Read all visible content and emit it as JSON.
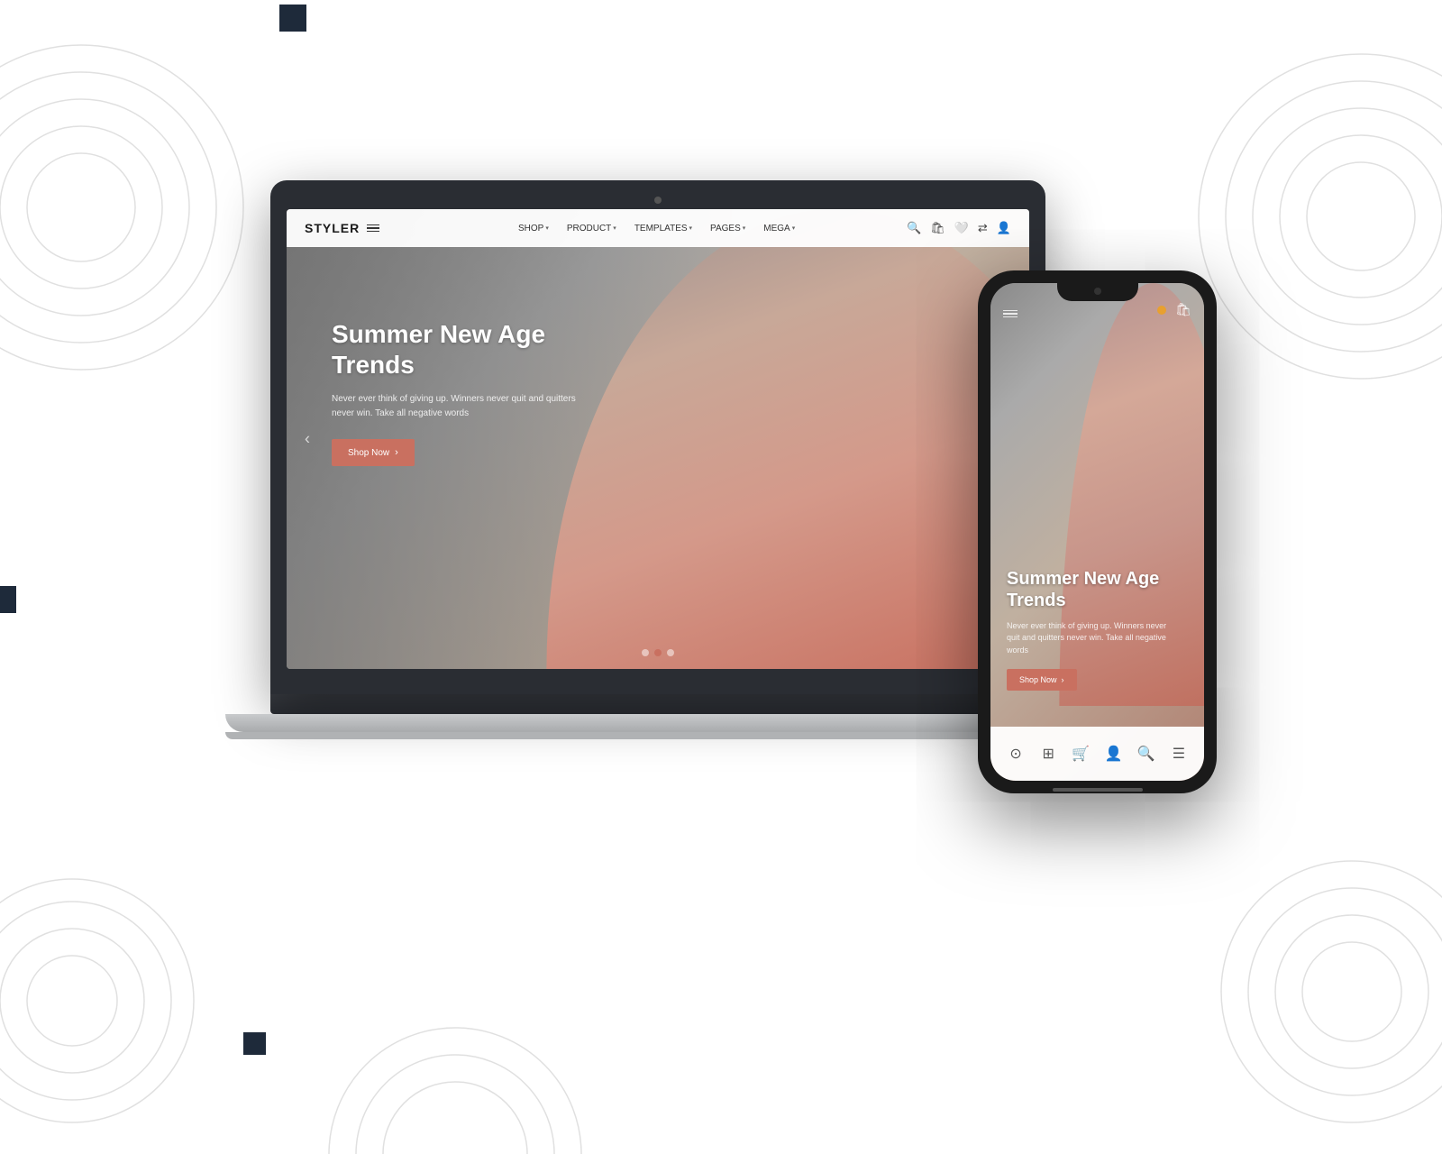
{
  "background": {
    "color": "#ffffff"
  },
  "laptop": {
    "nav": {
      "logo": "STYLER",
      "links": [
        {
          "label": "SHOP",
          "has_dropdown": true
        },
        {
          "label": "PRODUCT",
          "has_dropdown": true
        },
        {
          "label": "TEMPLATES",
          "has_dropdown": true
        },
        {
          "label": "PAGES",
          "has_dropdown": true
        },
        {
          "label": "MEGA",
          "has_dropdown": true
        }
      ]
    },
    "hero": {
      "title": "Summer New Age Trends",
      "subtitle": "Never ever think of giving up. Winners never quit and quitters never win. Take all negative words",
      "cta_label": "Shop Now"
    }
  },
  "phone": {
    "hero": {
      "title": "Summer New Age Trends",
      "subtitle": "Never ever think of giving up. Winners never quit and quitters never win. Take all negative words",
      "cta_label": "Shop Now"
    }
  },
  "decorations": {
    "accent_color": "#c97060",
    "dark_color": "#1e2a3a"
  }
}
